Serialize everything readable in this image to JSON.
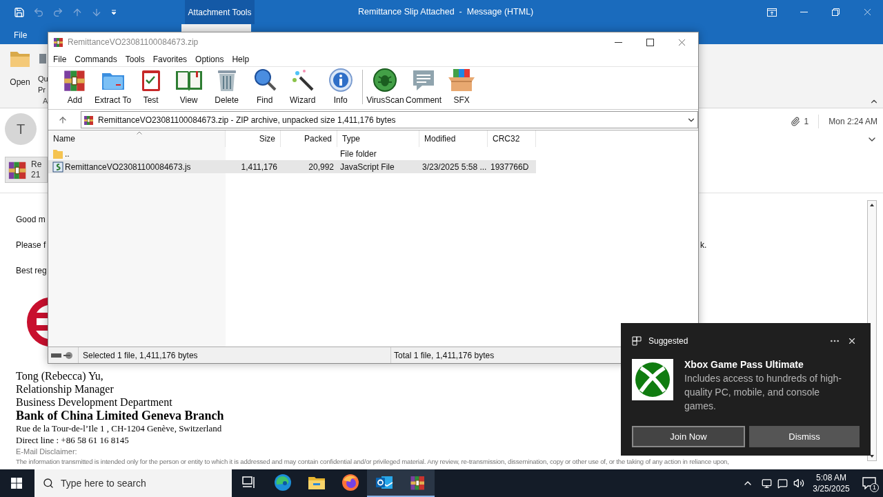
{
  "outlook": {
    "title": "Remittance Slip Attached  -  Message (HTML)",
    "context_group": "Attachment Tools",
    "file_tab": "File",
    "ribbon": {
      "open": "Open",
      "partial_button": [
        "Qu",
        "Pr"
      ],
      "group_label": "A"
    },
    "sender_initial": "T",
    "attachment": {
      "name": "Re",
      "size": "21"
    },
    "attachment_count": "1",
    "received": "Mon 2:24 AM",
    "lines": [
      {
        "text": "Good m"
      },
      {
        "text": "Please f",
        "tail": "k."
      },
      {
        "text": "Best reg"
      }
    ],
    "signature": [
      {
        "kind": "line",
        "text": "Tong (Rebecca) Yu,"
      },
      {
        "kind": "line",
        "text": "Relationship Manager"
      },
      {
        "kind": "line",
        "text": "Business Development Department"
      },
      {
        "kind": "bank",
        "text": "Bank of China Limited Geneva Branch"
      },
      {
        "kind": "address",
        "text": "Rue de la Tour-de-l’Ile 1 , CH-1204 Genève, Switzerland"
      },
      {
        "kind": "address",
        "text": "Direct line : +86 58 61 16 8145"
      },
      {
        "kind": "disclaimer_title",
        "text": "E-Mail Disclaimer:"
      },
      {
        "kind": "disclaimer",
        "text": "The information transmitted is intended only for the person or entity to which it is addressed and may contain confidential and/or privileged material. Any review, re-transmission, dissemination, copy or other use of, or the taking of any action in reliance upon,"
      }
    ]
  },
  "winrar": {
    "title": "RemittanceVO23081100084673.zip",
    "menu": [
      "File",
      "Commands",
      "Tools",
      "Favorites",
      "Options",
      "Help"
    ],
    "toolbar": [
      {
        "kind": "add",
        "label": "Add"
      },
      {
        "kind": "extract",
        "label": "Extract To"
      },
      {
        "kind": "test",
        "label": "Test"
      },
      {
        "kind": "view",
        "label": "View"
      },
      {
        "kind": "delete",
        "label": "Delete"
      },
      {
        "kind": "find",
        "label": "Find"
      },
      {
        "kind": "wizard",
        "label": "Wizard"
      },
      {
        "kind": "info",
        "label": "Info"
      },
      {
        "kind": "virusscan",
        "label": "VirusScan",
        "separated": true
      },
      {
        "kind": "comment",
        "label": "Comment"
      },
      {
        "kind": "sfx",
        "label": "SFX"
      }
    ],
    "path": "RemittanceVO23081100084673.zip - ZIP archive, unpacked size 1,411,176 bytes",
    "columns": [
      {
        "label": "Name",
        "sorted": true
      },
      {
        "label": "Size",
        "sorted": false
      },
      {
        "label": "Packed",
        "sorted": false
      },
      {
        "label": "Type",
        "sorted": false
      },
      {
        "label": "Modified",
        "sorted": false
      },
      {
        "label": "CRC32",
        "sorted": false
      }
    ],
    "rows": [
      {
        "kind": "folder",
        "name": "..",
        "type": "File folder",
        "selected": false
      },
      {
        "kind": "script",
        "name": "RemittanceVO23081100084673.js",
        "size": "1,411,176",
        "packed": "20,992",
        "type": "JavaScript File",
        "modified": "3/23/2025 5:58 ...",
        "crc32": "1937766D",
        "selected": true
      }
    ],
    "status": {
      "selected": "Selected 1 file, 1,411,176 bytes",
      "total": "Total 1 file, 1,411,176 bytes"
    }
  },
  "toast": {
    "header": "Suggested",
    "title": "Xbox Game Pass Ultimate",
    "body": "Includes access to hundreds of high-quality PC, mobile, and console games.",
    "buttons": [
      "Join Now",
      "Dismiss"
    ]
  },
  "taskbar": {
    "search_placeholder": "Type here to search",
    "apps": [
      {
        "kind": "task_view",
        "active": false
      },
      {
        "kind": "edge",
        "active": false
      },
      {
        "kind": "explorer",
        "active": false
      },
      {
        "kind": "firefox",
        "active": false
      },
      {
        "kind": "outlook",
        "active": true
      },
      {
        "kind": "winrar",
        "active": true
      }
    ],
    "time": "5:08 AM",
    "date": "3/25/2025",
    "notifications": "1"
  }
}
